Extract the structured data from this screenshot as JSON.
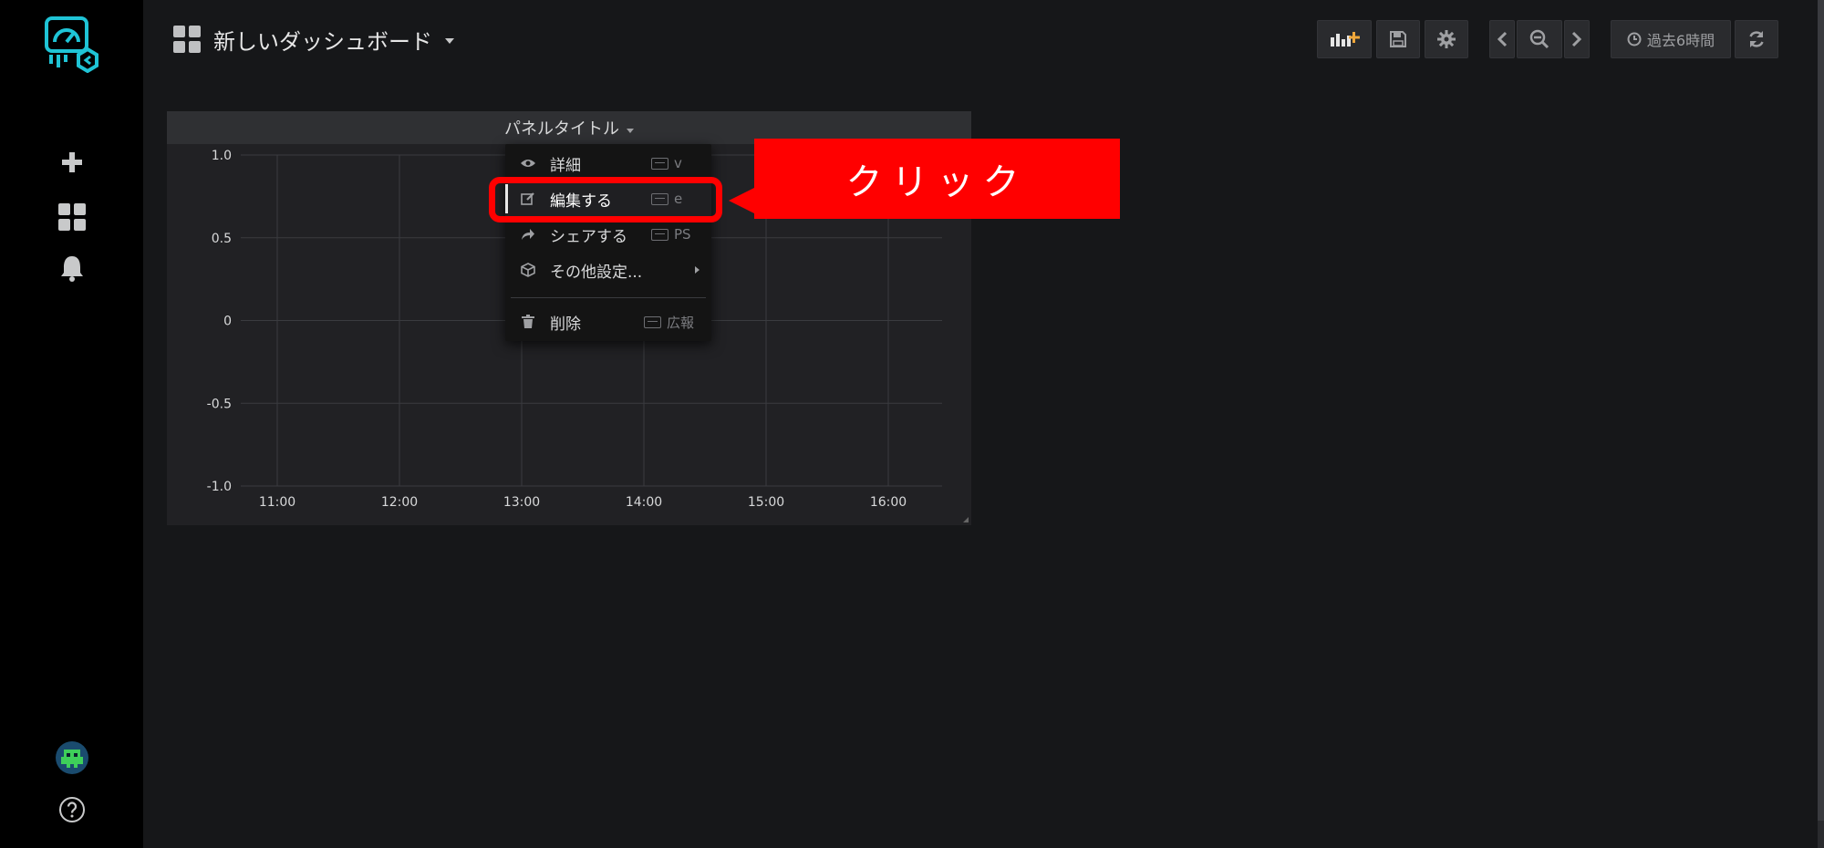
{
  "dashboard": {
    "title": "新しいダッシュボード"
  },
  "toolbar": {
    "time_range": "過去6時間"
  },
  "panel": {
    "title": "パネルタイトル",
    "menu": [
      {
        "label": "詳細",
        "shortcut": "v",
        "icon": "eye-icon"
      },
      {
        "label": "編集する",
        "shortcut": "e",
        "icon": "edit-icon"
      },
      {
        "label": "シェアする",
        "shortcut": "PS",
        "icon": "share-icon"
      },
      {
        "label": "その他設定...",
        "shortcut": "",
        "icon": "cube-icon"
      },
      {
        "label": "削除",
        "shortcut": "広報",
        "icon": "trash-icon"
      }
    ]
  },
  "annotation": {
    "callout": "クリック",
    "color": "#ff0000"
  },
  "chart_data": {
    "type": "line",
    "x": [
      "11:00",
      "12:00",
      "13:00",
      "14:00",
      "15:00",
      "16:00"
    ],
    "y_ticks": [
      "1.0",
      "0.5",
      "0",
      "-0.5",
      "-1.0"
    ],
    "ylim": [
      -1.0,
      1.0
    ],
    "series": [],
    "grid": true
  },
  "colors": {
    "background": "#161719",
    "sidebar": "#000000",
    "accent": "#33b5e5",
    "highlight": "#ff0000"
  }
}
